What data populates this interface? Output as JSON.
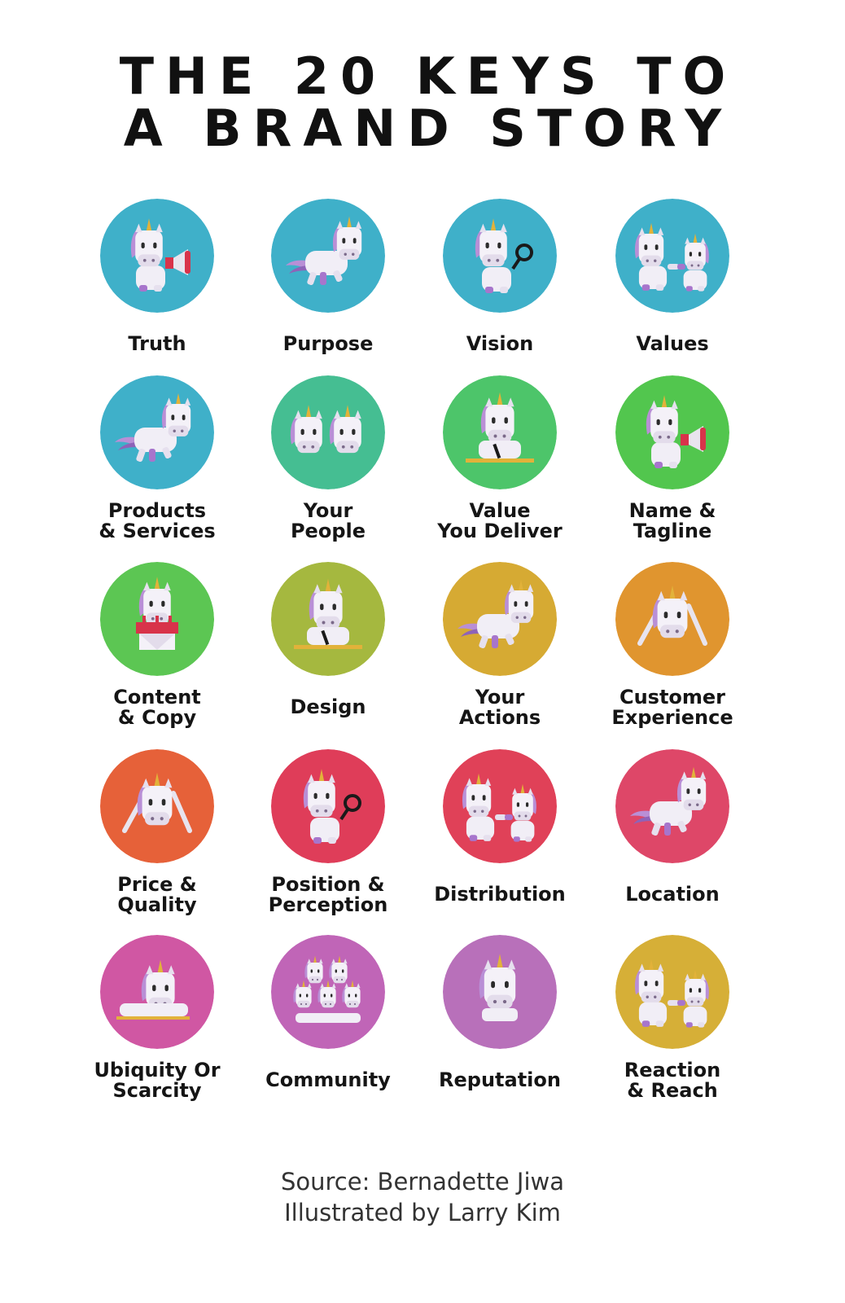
{
  "title": {
    "line1": "THE 20 KEYS TO",
    "line2": "A BRAND STORY"
  },
  "keys": [
    {
      "lines": [
        "Truth"
      ],
      "color": "#3FB0C9",
      "icon": "unicorn-megaphone-icon"
    },
    {
      "lines": [
        "Purpose"
      ],
      "color": "#3FB0C9",
      "icon": "unicorn-prancing-icon"
    },
    {
      "lines": [
        "Vision"
      ],
      "color": "#3FB0C9",
      "icon": "unicorn-magnifier-icon"
    },
    {
      "lines": [
        "Values"
      ],
      "color": "#3FB0C9",
      "icon": "unicorn-pair-icon"
    },
    {
      "lines": [
        "Products",
        "& Services"
      ],
      "color": "#3FB0C9",
      "icon": "unicorn-prancing-icon"
    },
    {
      "lines": [
        "Your",
        "People"
      ],
      "color": "#45BE92",
      "icon": "unicorn-two-faces-icon"
    },
    {
      "lines": [
        "Value",
        "You Deliver"
      ],
      "color": "#4DC56A",
      "icon": "unicorn-desk-icon"
    },
    {
      "lines": [
        "Name &",
        "Tagline"
      ],
      "color": "#52C64E",
      "icon": "unicorn-megaphone-icon"
    },
    {
      "lines": [
        "Content",
        "& Copy"
      ],
      "color": "#5CC653",
      "icon": "unicorn-cake-icon"
    },
    {
      "lines": [
        "Design"
      ],
      "color": "#A5B83F",
      "icon": "unicorn-desk-icon"
    },
    {
      "lines": [
        "Your",
        "Actions"
      ],
      "color": "#D6AA33",
      "icon": "unicorn-prancing-icon"
    },
    {
      "lines": [
        "Customer",
        "Experience"
      ],
      "color": "#E0952F",
      "icon": "unicorn-swords-icon"
    },
    {
      "lines": [
        "Price &",
        "Quality"
      ],
      "color": "#E66139",
      "icon": "unicorn-swords-icon"
    },
    {
      "lines": [
        "Position &",
        "Perception"
      ],
      "color": "#DF3D59",
      "icon": "unicorn-magnifier-icon"
    },
    {
      "lines": [
        "Distribution"
      ],
      "color": "#E04158",
      "icon": "unicorn-pair-icon"
    },
    {
      "lines": [
        "Location"
      ],
      "color": "#DE4768",
      "icon": "unicorn-prancing-icon"
    },
    {
      "lines": [
        "Ubiquity Or",
        "Scarcity"
      ],
      "color": "#D057A3",
      "icon": "unicorn-lying-icon"
    },
    {
      "lines": [
        "Community"
      ],
      "color": "#C065B7",
      "icon": "unicorn-group-icon"
    },
    {
      "lines": [
        "Reputation"
      ],
      "color": "#B870BA",
      "icon": "unicorn-face-icon"
    },
    {
      "lines": [
        "Reaction",
        "& Reach"
      ],
      "color": "#D6AF37",
      "icon": "unicorn-pair-icon"
    }
  ],
  "source": {
    "line1": "Source: Bernadette Jiwa",
    "line2": "Illustrated by Larry Kim"
  }
}
